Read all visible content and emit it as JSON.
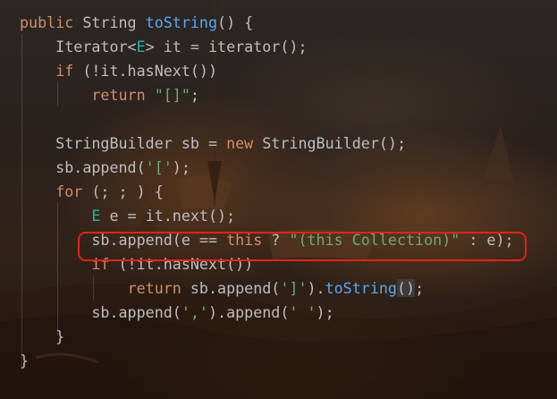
{
  "editor": {
    "language": "Java",
    "lines": [
      [
        {
          "t": "public",
          "c": "kw"
        },
        {
          "t": " String ",
          "c": "plain"
        },
        {
          "t": "toString",
          "c": "fn"
        },
        {
          "t": "() {",
          "c": "plain"
        }
      ],
      [
        {
          "t": "    Iterator<",
          "c": "plain"
        },
        {
          "t": "E",
          "c": "tp"
        },
        {
          "t": "> it = iterator();",
          "c": "plain"
        }
      ],
      [
        {
          "t": "    ",
          "c": "plain"
        },
        {
          "t": "if",
          "c": "kw"
        },
        {
          "t": " (!it.hasNext())",
          "c": "plain"
        }
      ],
      [
        {
          "t": "        ",
          "c": "plain"
        },
        {
          "t": "return",
          "c": "kw"
        },
        {
          "t": " ",
          "c": "plain"
        },
        {
          "t": "\"[]\"",
          "c": "str"
        },
        {
          "t": ";",
          "c": "plain"
        }
      ],
      [],
      [
        {
          "t": "    StringBuilder sb = ",
          "c": "plain"
        },
        {
          "t": "new",
          "c": "kw"
        },
        {
          "t": " StringBuilder();",
          "c": "plain"
        }
      ],
      [
        {
          "t": "    sb.append(",
          "c": "plain"
        },
        {
          "t": "'['",
          "c": "str"
        },
        {
          "t": ");",
          "c": "plain"
        }
      ],
      [
        {
          "t": "    ",
          "c": "plain"
        },
        {
          "t": "for",
          "c": "kw"
        },
        {
          "t": " (; ; ) {",
          "c": "plain"
        }
      ],
      [
        {
          "t": "        ",
          "c": "plain"
        },
        {
          "t": "E",
          "c": "tp"
        },
        {
          "t": " e = it.next();",
          "c": "plain"
        }
      ],
      [
        {
          "t": "        sb.append(e == ",
          "c": "plain"
        },
        {
          "t": "this",
          "c": "kw"
        },
        {
          "t": " ? ",
          "c": "plain"
        },
        {
          "t": "\"(this Collection)\"",
          "c": "str"
        },
        {
          "t": " : e);",
          "c": "plain"
        }
      ],
      [
        {
          "t": "        ",
          "c": "plain"
        },
        {
          "t": "if",
          "c": "kw"
        },
        {
          "t": " (!it.hasNext())",
          "c": "plain"
        }
      ],
      [
        {
          "t": "            ",
          "c": "plain"
        },
        {
          "t": "return",
          "c": "kw"
        },
        {
          "t": " sb.append(",
          "c": "plain"
        },
        {
          "t": "']'",
          "c": "str"
        },
        {
          "t": ").",
          "c": "plain"
        },
        {
          "t": "toString",
          "c": "fn"
        },
        {
          "t": "();",
          "c": "plain",
          "hl": true
        }
      ],
      [
        {
          "t": "        sb.append(",
          "c": "plain"
        },
        {
          "t": "','",
          "c": "str"
        },
        {
          "t": ").append(",
          "c": "plain"
        },
        {
          "t": "' '",
          "c": "str"
        },
        {
          "t": ");",
          "c": "plain"
        }
      ],
      [
        {
          "t": "    }",
          "c": "plain"
        }
      ],
      [
        {
          "t": "}",
          "c": "plain"
        }
      ]
    ],
    "highlighted_line_index": 9
  },
  "colors": {
    "keyword": "#cf8e6d",
    "method": "#56a8f5",
    "string": "#6aab73",
    "type_param": "#16baac",
    "text": "#bcbec4",
    "highlight_border": "#e0241b"
  }
}
